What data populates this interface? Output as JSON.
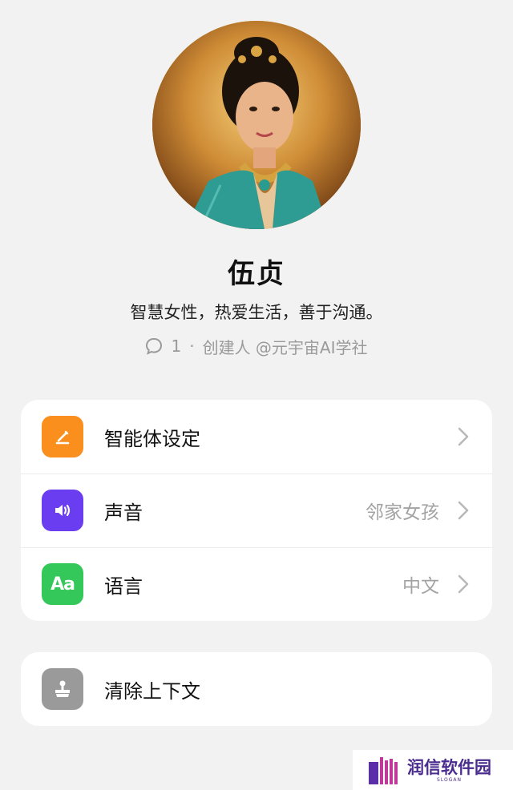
{
  "profile": {
    "name": "伍贞",
    "bio": "智慧女性，热爱生活，善于沟通。",
    "chat_count": "1",
    "separator": "·",
    "creator": "创建人 @元宇宙AI学社"
  },
  "settings": {
    "items": [
      {
        "label": "智能体设定",
        "value": "",
        "icon": "edit-pen-icon",
        "color": "#fa8f1d"
      },
      {
        "label": "声音",
        "value": "邻家女孩",
        "icon": "speaker-icon",
        "color": "#6a3df0"
      },
      {
        "label": "语言",
        "value": "中文",
        "icon": "language-aa-icon",
        "icon_text": "Aa",
        "color": "#34c759"
      }
    ]
  },
  "actions": {
    "clear_context_label": "清除上下文",
    "clear_context_icon": "broom-icon",
    "clear_context_color": "#9a9a9a"
  },
  "watermark": {
    "name": "润信软件园",
    "slogan": "SLOGAN"
  }
}
